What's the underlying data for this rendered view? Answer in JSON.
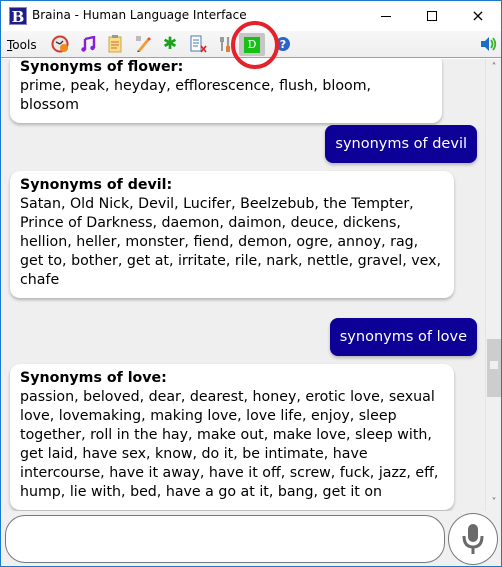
{
  "window": {
    "title": "Braina - Human Language Interface",
    "logo_letter": "B",
    "controls": {
      "minimize": "minimize",
      "maximize": "maximize",
      "close": "×"
    }
  },
  "toolbar": {
    "menu_label_underlined": "T",
    "menu_label_rest": "ools",
    "icons": [
      {
        "name": "alarm-clock-icon"
      },
      {
        "name": "music-note-icon"
      },
      {
        "name": "notepad-icon"
      },
      {
        "name": "pencil-eraser-icon"
      },
      {
        "name": "asterisk-icon",
        "glyph": "✱"
      },
      {
        "name": "document-mute-icon"
      },
      {
        "name": "tools-icon"
      },
      {
        "name": "dictation-d-icon",
        "glyph": "D",
        "highlighted": true
      },
      {
        "name": "help-icon",
        "glyph": "?"
      },
      {
        "name": "speaker-icon"
      }
    ]
  },
  "colors": {
    "user_bubble": "#0c0096",
    "chat_background": "#efefef",
    "highlight_circle": "#e5212b",
    "dictation_green": "#16c016"
  },
  "chat": {
    "messages": [
      {
        "role": "assistant",
        "heading": "Synonyms of flower:",
        "body": "prime, peak, heyday, efflorescence, flush, bloom, blossom"
      },
      {
        "role": "user",
        "text": "synonyms of devil"
      },
      {
        "role": "assistant",
        "heading": "Synonyms of devil:",
        "body": "Satan, Old Nick, Devil, Lucifer, Beelzebub, the Tempter, Prince of Darkness, daemon, daimon, deuce, dickens, hellion, heller, monster, fiend, demon, ogre, annoy, rag, get to, bother, get at, irritate, rile, nark, nettle, gravel, vex, chafe"
      },
      {
        "role": "user",
        "text": "synonyms of love"
      },
      {
        "role": "assistant",
        "heading": "Synonyms of love:",
        "body": "passion, beloved, dear, dearest, honey, erotic love, sexual love, lovemaking, making love, love life, enjoy, sleep together, roll in the hay, make out, make love, sleep with, get laid, have sex, know, do it, be intimate, have intercourse, have it away, have it off, screw, fuck, jazz, eff, hump, lie with, bed, have a go at it, bang, get it on"
      }
    ]
  },
  "scrollbar": {
    "up": "˄",
    "down": "˅",
    "position_fraction": 0.65
  },
  "input": {
    "value": "",
    "placeholder": ""
  }
}
